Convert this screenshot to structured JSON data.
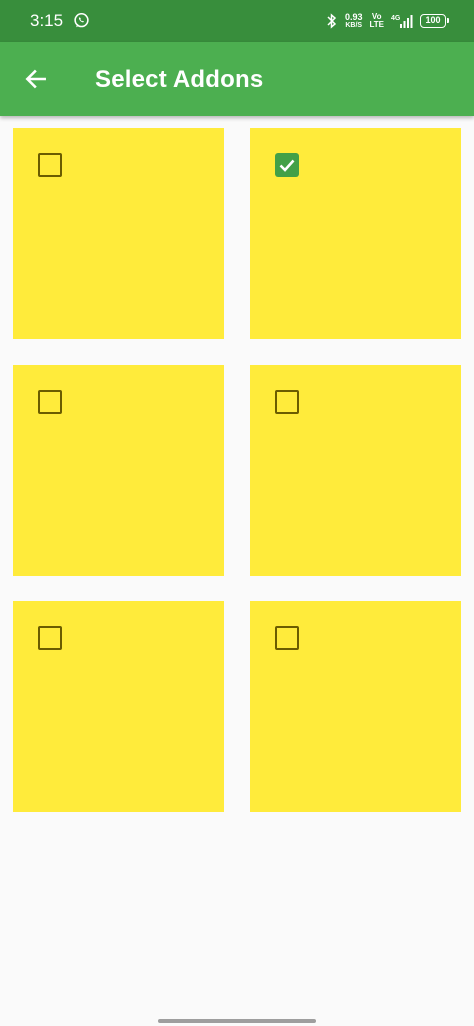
{
  "status_bar": {
    "time": "3:15",
    "net_speed_value": "0.93",
    "net_speed_unit": "KB/S",
    "volte_top": "Vo",
    "volte_bottom": "LTE",
    "network_type": "4G",
    "battery_level": "100",
    "icons": [
      "whatsapp-icon",
      "bluetooth-icon",
      "signal-icon",
      "battery-icon"
    ]
  },
  "app_bar": {
    "title": "Select Addons",
    "back_icon": "arrow-left-icon"
  },
  "addons": [
    {
      "checked": false
    },
    {
      "checked": true
    },
    {
      "checked": false
    },
    {
      "checked": false
    },
    {
      "checked": false
    },
    {
      "checked": false
    }
  ],
  "colors": {
    "status_bar": "#388e3c",
    "app_bar": "#4caf50",
    "tile": "#ffeb3b",
    "checkbox_checked": "#43a047",
    "checkbox_border": "#6b5c00",
    "background": "#fafafa"
  }
}
